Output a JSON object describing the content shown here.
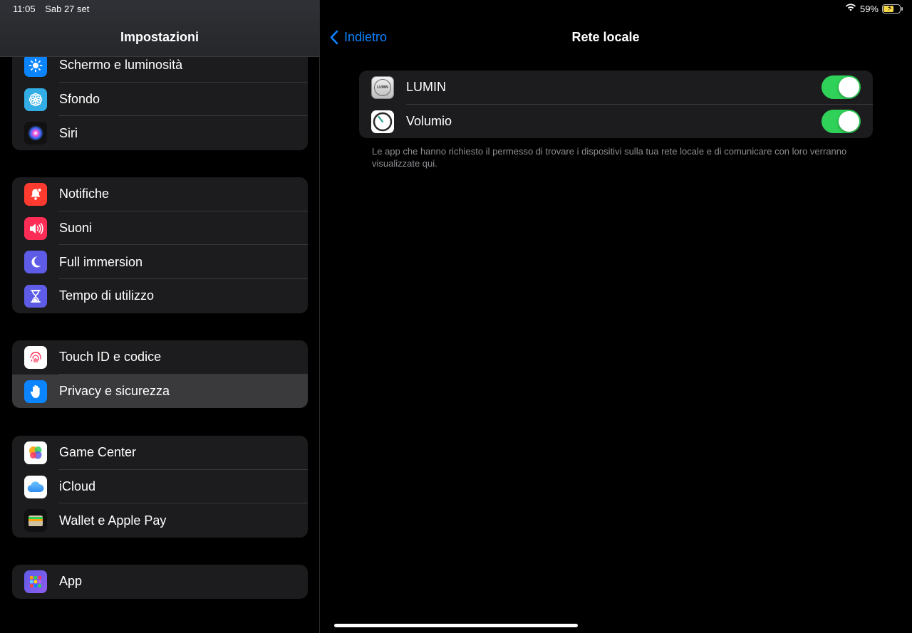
{
  "status": {
    "time": "11:05",
    "date": "Sab 27 set",
    "battery": "59%"
  },
  "sidebar": {
    "title": "Impostazioni",
    "groups": [
      [
        {
          "label": "Schermo e luminosità",
          "icon": "sun-icon",
          "color": "#0a84ff"
        },
        {
          "label": "Sfondo",
          "icon": "flower-icon",
          "color": "#32ade6"
        },
        {
          "label": "Siri",
          "icon": "siri-icon",
          "color": "#1a1a1a"
        }
      ],
      [
        {
          "label": "Notifiche",
          "icon": "bell-icon",
          "color": "#ff3b30"
        },
        {
          "label": "Suoni",
          "icon": "speaker-icon",
          "color": "#ff2d55"
        },
        {
          "label": "Full immersion",
          "icon": "moon-icon",
          "color": "#5e5ce6"
        },
        {
          "label": "Tempo di utilizzo",
          "icon": "hourglass-icon",
          "color": "#5e5ce6"
        }
      ],
      [
        {
          "label": "Touch ID e codice",
          "icon": "fingerprint-icon",
          "color": "#ffffff"
        },
        {
          "label": "Privacy e sicurezza",
          "icon": "hand-icon",
          "color": "#0a84ff"
        }
      ],
      [
        {
          "label": "Game Center",
          "icon": "game-center-icon",
          "color": "#ffffff"
        },
        {
          "label": "iCloud",
          "icon": "cloud-icon",
          "color": "#ffffff"
        },
        {
          "label": "Wallet e Apple Pay",
          "icon": "wallet-icon",
          "color": "#1a1a1a"
        }
      ],
      [
        {
          "label": "App",
          "icon": "apps-grid-icon",
          "color": "#5e5ce6"
        }
      ]
    ]
  },
  "detail": {
    "back_label": "Indietro",
    "title": "Rete locale",
    "apps": [
      {
        "label": "LUMIN",
        "icon": "lumin-app-icon",
        "icon_text": "LUMIN",
        "enabled": true
      },
      {
        "label": "Volumio",
        "icon": "volumio-app-icon",
        "enabled": true
      }
    ],
    "footnote": "Le app che hanno richiesto il permesso di trovare i dispositivi sulla tua rete locale e di comunicare con loro verranno visualizzate qui."
  },
  "colors": {
    "accent": "#0a84ff",
    "toggle_on": "#30d158"
  }
}
